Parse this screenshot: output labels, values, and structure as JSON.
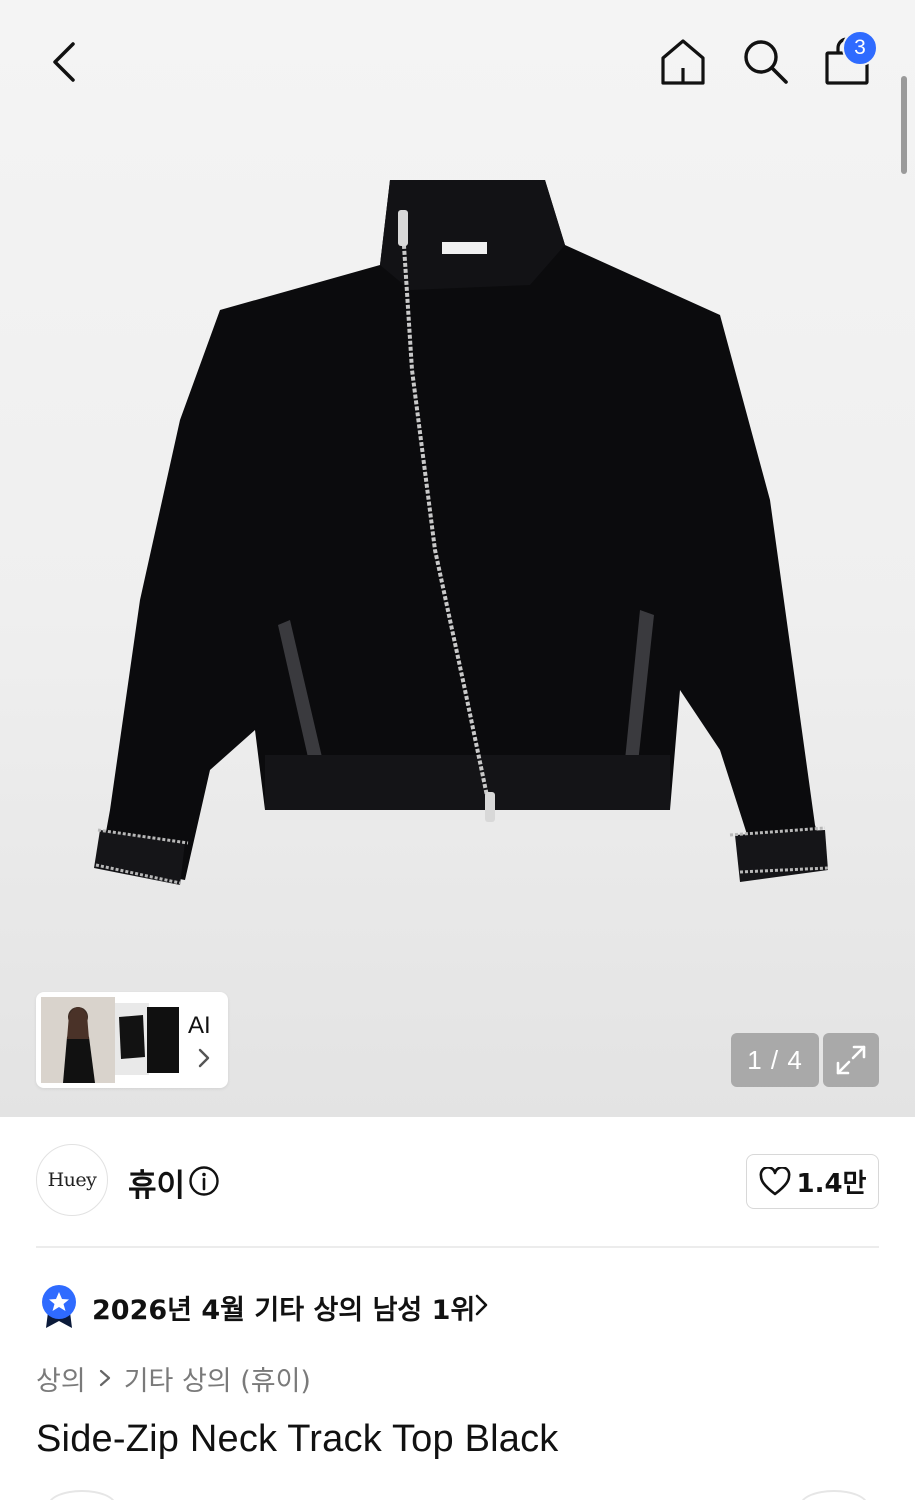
{
  "header": {
    "cart_count": "3"
  },
  "gallery": {
    "ai_label": "AI",
    "page_indicator": "1 / 4"
  },
  "brand": {
    "logo_text": "Huey",
    "name": "휴이",
    "like_count": "1.4만"
  },
  "ranking": {
    "text": "2026년 4월 기타 상의 남성 1위"
  },
  "breadcrumb": {
    "items": [
      "상의",
      "기타 상의 (휴이)"
    ]
  },
  "product": {
    "title": "Side-Zip Neck Track Top Black"
  },
  "colors": {
    "accent": "#2f6bff",
    "text": "#111111",
    "muted": "#7a7a7a"
  },
  "icons": [
    "back-arrow-icon",
    "home-icon",
    "search-icon",
    "shopping-bag-icon",
    "chevron-right-icon",
    "expand-icon",
    "info-icon",
    "heart-icon",
    "ranking-medal-icon"
  ]
}
